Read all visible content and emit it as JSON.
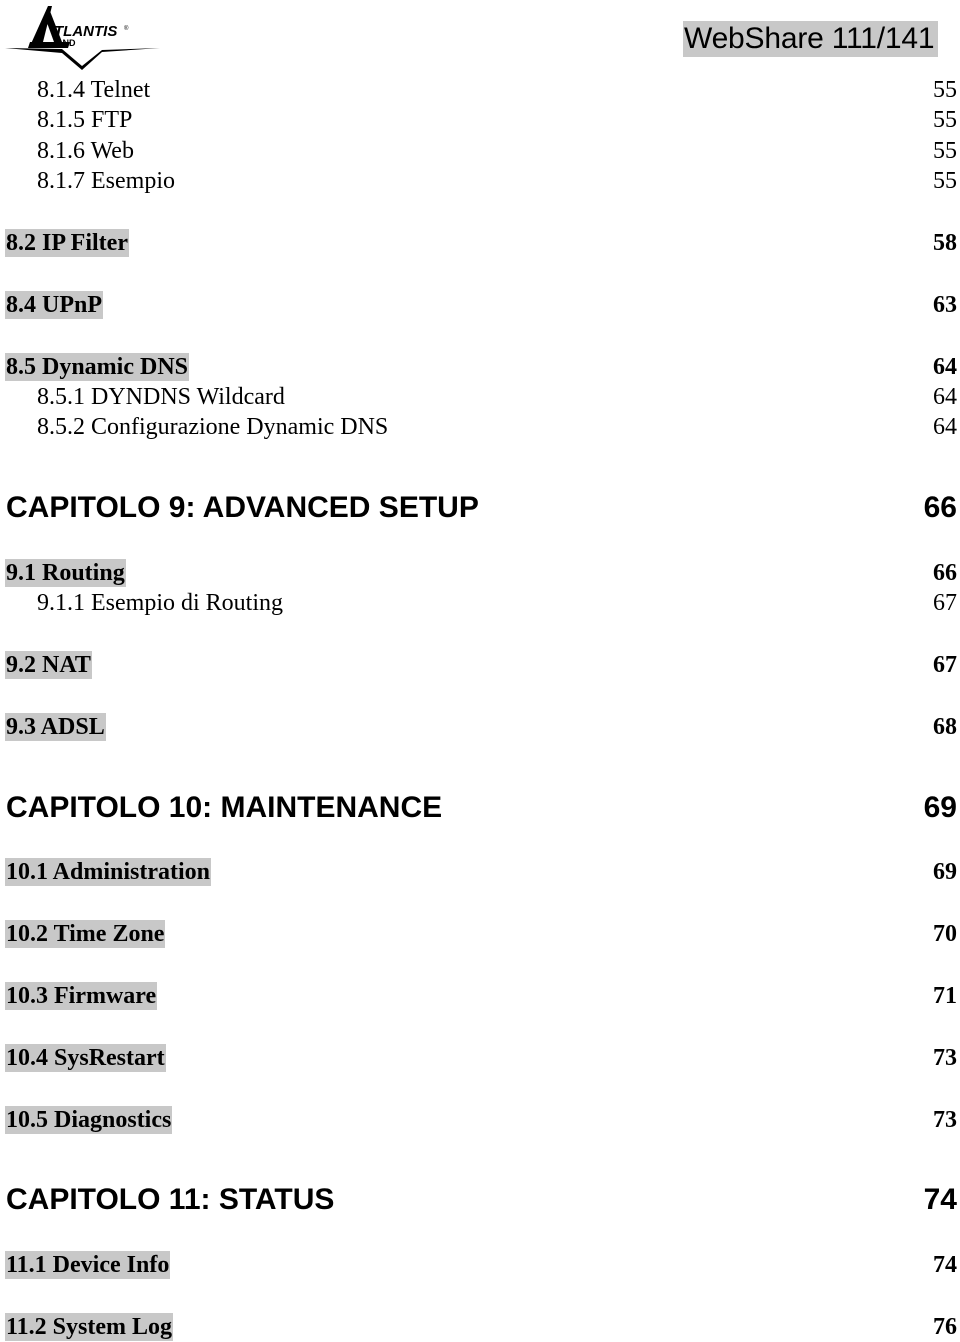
{
  "header": {
    "logo_text": "ATLANTIS LAND",
    "title": "WebShare 111/141"
  },
  "highlight_color": "#c8c8c8",
  "toc": [
    {
      "type": "sub",
      "label": "8.1.4 Telnet",
      "page": "55"
    },
    {
      "type": "sub",
      "label": "8.1.5 FTP",
      "page": "55"
    },
    {
      "type": "sub",
      "label": "8.1.6 Web",
      "page": "55"
    },
    {
      "type": "sub",
      "label": "8.1.7 Esempio",
      "page": "55"
    },
    {
      "type": "sec",
      "label": "8.2 IP Filter",
      "page": "58"
    },
    {
      "type": "sec",
      "label": "8.4 UPnP",
      "page": "63"
    },
    {
      "type": "sec",
      "label": "8.5 Dynamic DNS",
      "page": "64"
    },
    {
      "type": "sub",
      "label": "8.5.1 DYNDNS Wildcard",
      "page": "64"
    },
    {
      "type": "sub",
      "label": "8.5.2 Configurazione Dynamic DNS",
      "page": "64"
    },
    {
      "type": "chap",
      "label": "CAPITOLO 9: ADVANCED SETUP",
      "page": "66"
    },
    {
      "type": "sec",
      "label": "9.1 Routing",
      "page": "66"
    },
    {
      "type": "sub",
      "label": "9.1.1 Esempio di Routing",
      "page": "67"
    },
    {
      "type": "sec",
      "label": "9.2 NAT",
      "page": "67"
    },
    {
      "type": "sec",
      "label": "9.3 ADSL",
      "page": "68"
    },
    {
      "type": "chap",
      "label": "CAPITOLO 10: MAINTENANCE",
      "page": "69"
    },
    {
      "type": "sec",
      "label": "10.1 Administration",
      "page": "69"
    },
    {
      "type": "sec",
      "label": "10.2 Time Zone",
      "page": "70"
    },
    {
      "type": "sec",
      "label": "10.3 Firmware",
      "page": "71"
    },
    {
      "type": "sec",
      "label": "10.4 SysRestart",
      "page": "73"
    },
    {
      "type": "sec",
      "label": "10.5 Diagnostics",
      "page": "73"
    },
    {
      "type": "chap",
      "label": "CAPITOLO 11: STATUS",
      "page": "74"
    },
    {
      "type": "sec",
      "label": "11.1 Device Info",
      "page": "74"
    },
    {
      "type": "sec",
      "label": "11.2 System Log",
      "page": "76"
    }
  ]
}
